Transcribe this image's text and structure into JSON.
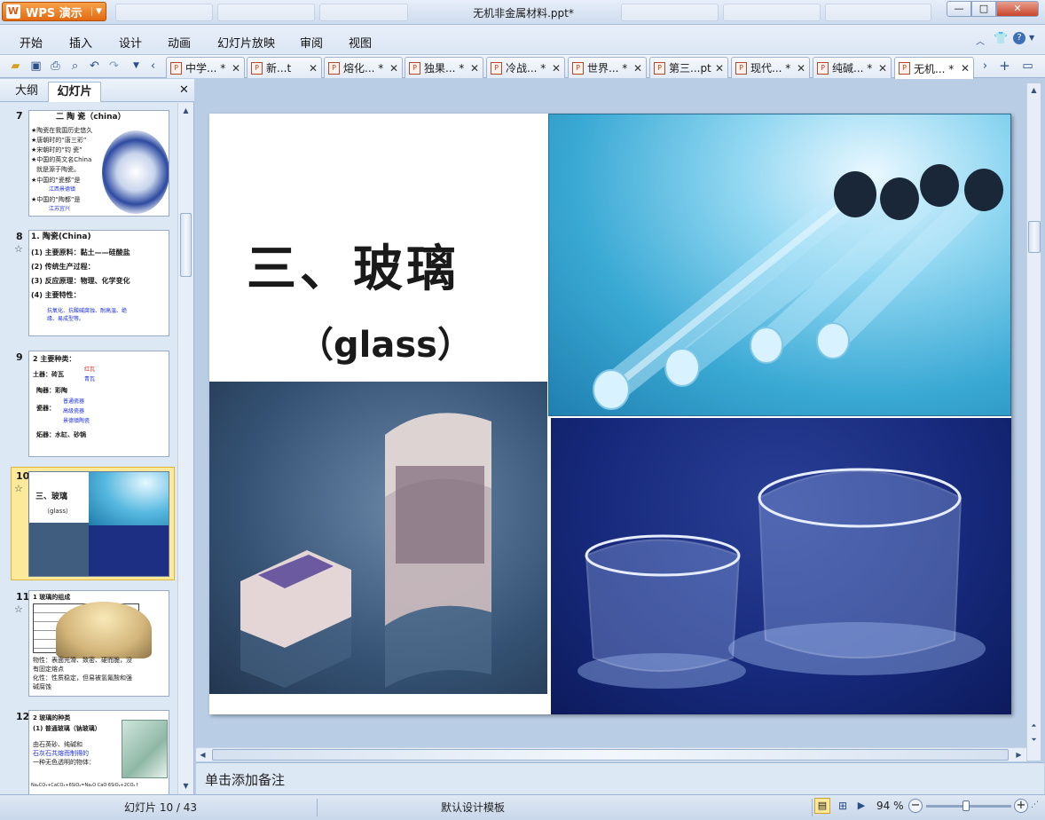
{
  "app": {
    "name": "WPS 演示",
    "logo_glyph": "W"
  },
  "window": {
    "title": "无机非金属材料.ppt*",
    "minimize_glyph": "—",
    "maximize_glyph": "□",
    "close_glyph": "✕"
  },
  "menu": {
    "items": [
      "开始",
      "插入",
      "设计",
      "动画",
      "幻灯片放映",
      "审阅",
      "视图"
    ]
  },
  "doc_tabs": [
    {
      "label": "中学... *"
    },
    {
      "label": "新...t"
    },
    {
      "label": "熔化... *"
    },
    {
      "label": "独果... *"
    },
    {
      "label": "冷战... *"
    },
    {
      "label": "世界... *"
    },
    {
      "label": "第三...pt"
    },
    {
      "label": "现代... *"
    },
    {
      "label": "纯碱... *"
    },
    {
      "label": "无机... *"
    }
  ],
  "left_panel": {
    "tabs": [
      "大纲",
      "幻灯片"
    ],
    "close_glyph": "✕",
    "slides": [
      {
        "num": "7",
        "lines": [
          "二 陶 瓷（china）",
          "★陶瓷在我国历史悠久",
          "★唐朝时的“唐三彩”",
          "★宋朝时的“钧 瓷”",
          "★中国的英文名China",
          "就是源于陶瓷。",
          "★中国的“瓷都”是",
          "江西景德镇",
          "★中国的“陶都”是",
          "江苏宜兴"
        ]
      },
      {
        "num": "8",
        "lines": [
          "1. 陶瓷(China)",
          "(1) 主要原料：黏土——硅酸盐",
          "(2) 传统生产过程：",
          "(3) 反应原理：物理、化学变化",
          "(4) 主要特性：",
          "抗氧化、抗酸碱腐蚀、耐高温、绝",
          "缘、易成型等。"
        ]
      },
      {
        "num": "9",
        "lines": [
          "2 主要种类：",
          "土器：砖瓦",
          "红瓦",
          "青瓦",
          "陶器：彩陶",
          "瓷器：",
          "炻器：水缸、砂锅",
          "普通瓷器",
          "高级瓷器",
          "景德镇陶瓷"
        ]
      },
      {
        "num": "10",
        "lines": [
          "三、玻璃",
          "（glass）"
        ]
      },
      {
        "num": "11",
        "lines": [
          "1 玻璃的组成",
          "物性：表面光滑、致密、硬而脆，没",
          "有固定熔点",
          "化性：性质稳定，但易被氢氟酸和强",
          "碱腐蚀"
        ]
      },
      {
        "num": "12",
        "lines": [
          "2 玻璃的种类",
          "(1) 普通玻璃（钠玻璃）",
          "由石英砂、纯碱和",
          "石灰石共熔而制得的",
          "一种无色透明的物体：",
          "Na₂CO₃+CaCO₃+6SiO₂=Na₂O·CaO·6SiO₂+2CO₂↑"
        ]
      }
    ]
  },
  "slide": {
    "title": "三、玻璃",
    "subtitle": "（glass）"
  },
  "notes": {
    "placeholder": "单击添加备注"
  },
  "status": {
    "slide_info": "幻灯片 10 / 43",
    "template": "默认设计模板",
    "zoom": "94 %",
    "zoom_level": 0.94
  },
  "colors": {
    "accent": "#e26a12",
    "selected_thumb": "#fde99a",
    "slide_bg": "#b9cde5"
  }
}
